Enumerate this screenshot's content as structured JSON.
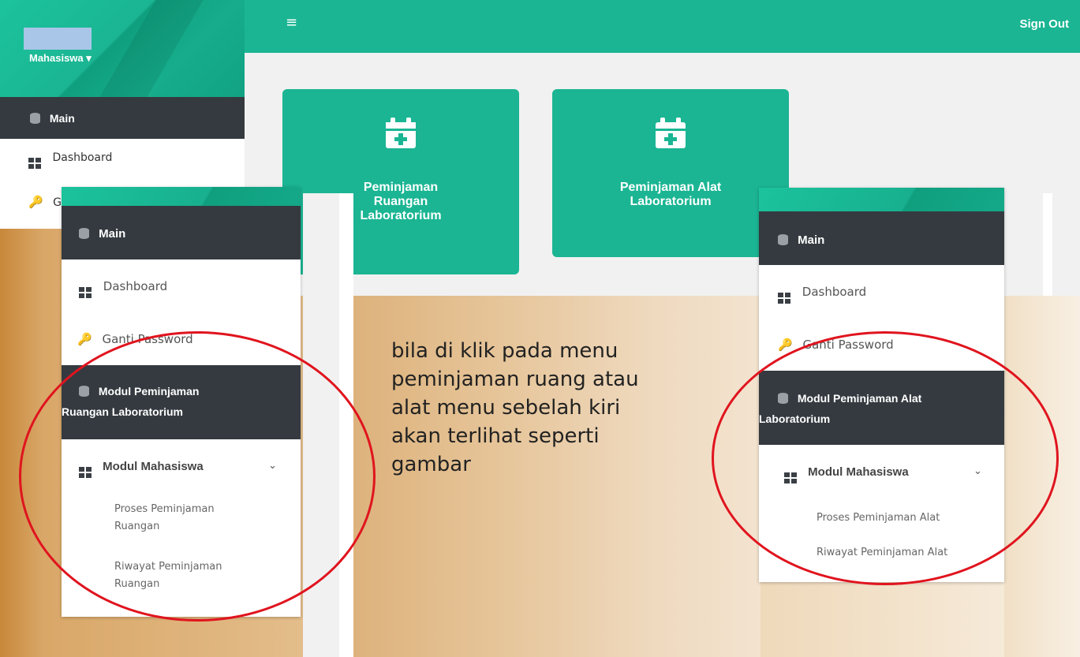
{
  "topbar": {
    "menu_icon": "hamburger-icon",
    "sign_out": "Sign Out"
  },
  "sidebar": {
    "role": "Mahasiswa",
    "role_caret": "▾",
    "main_label": "Main",
    "dashboard": "Dashboard",
    "ganti_password_truncated": "G"
  },
  "cards": [
    {
      "label_lines": [
        "Peminjaman",
        "Ruangan",
        "Laboratorium"
      ],
      "icon": "calendar-plus-icon"
    },
    {
      "label_lines": [
        "Peminjaman Alat",
        "Laboratorium"
      ],
      "icon": "calendar-plus-icon"
    }
  ],
  "left_panel": {
    "main": "Main",
    "dashboard": "Dashboard",
    "ganti_password": "Ganti Password",
    "modul_line1": "Modul Peminjaman",
    "modul_line2": "Ruangan Laboratorium",
    "modul_mahasiswa": "Modul Mahasiswa",
    "sub_items": [
      {
        "line1": "Proses Peminjaman",
        "line2": "Ruangan"
      },
      {
        "line1": "Riwayat Peminjaman",
        "line2": "Ruangan"
      }
    ]
  },
  "right_panel": {
    "main": "Main",
    "dashboard": "Dashboard",
    "ganti_password": "Ganti Password",
    "modul_line1": "Modul Peminjaman Alat",
    "modul_line2": "Laboratorium",
    "modul_mahasiswa": "Modul Mahasiswa",
    "sub_items": [
      "Proses Peminjaman Alat",
      "Riwayat Peminjaman Alat"
    ]
  },
  "note": {
    "lines": [
      "bila di klik pada menu",
      "peminjaman ruang atau",
      "alat menu sebelah kiri",
      "akan terlihat seperti",
      "gambar"
    ]
  },
  "colors": {
    "accent": "#1bb593",
    "dark_section": "#353a40",
    "highlight_circle": "#e0141e"
  }
}
